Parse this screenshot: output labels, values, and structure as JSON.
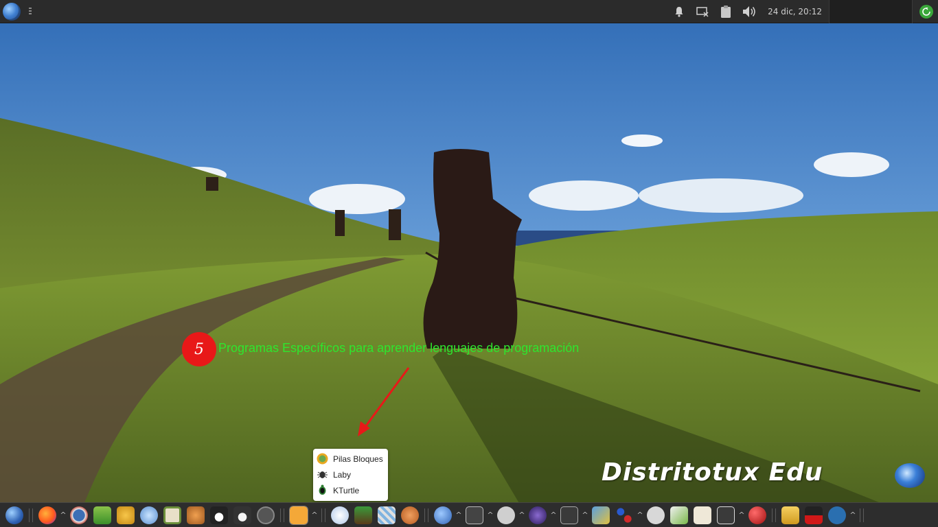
{
  "top_panel": {
    "clock": "24 dic, 20:12",
    "icons": [
      "app-menu-globe-icon",
      "bell-icon",
      "display-icon",
      "clipboard-icon",
      "volume-icon",
      "logout-icon"
    ]
  },
  "annotation": {
    "number": "5",
    "text": "Programas Específicos para aprender lenguajes de programación",
    "text_color": "#2ee62e",
    "badge_color": "#e81818"
  },
  "popup": {
    "items": [
      {
        "label": "Pilas Bloques",
        "icon": "pilas-bloques-icon"
      },
      {
        "label": "Laby",
        "icon": "laby-ant-icon"
      },
      {
        "label": "KTurtle",
        "icon": "kturtle-icon"
      }
    ]
  },
  "brand": {
    "text": "Distritotux Edu"
  },
  "taskbar": {
    "caret_glyph": "^",
    "launchers": [
      "globe-icon",
      "firefox-icon",
      "kde-edu-icon",
      "gcompris-icon",
      "hand-icon",
      "omnitux-icon",
      "tux-paint-board-icon",
      "tux-typing-icon",
      "penguin-icon",
      "abc-penguin-icon",
      "blue-circle-icon",
      "scratch-icon",
      "font-icon",
      "presentation-icon",
      "puzzle-icon",
      "horse-icon",
      "marble-globe-icon",
      "speech-icon",
      "circle-icon",
      "stellarium-icon",
      "math-icon",
      "image-icon",
      "molecule-icon",
      "sigma-icon",
      "geogebra-icon",
      "graph-icon",
      "dr-geo-icon",
      "red-ball-icon",
      "folder-icon",
      "gtick-icon",
      "musescore-icon"
    ]
  }
}
